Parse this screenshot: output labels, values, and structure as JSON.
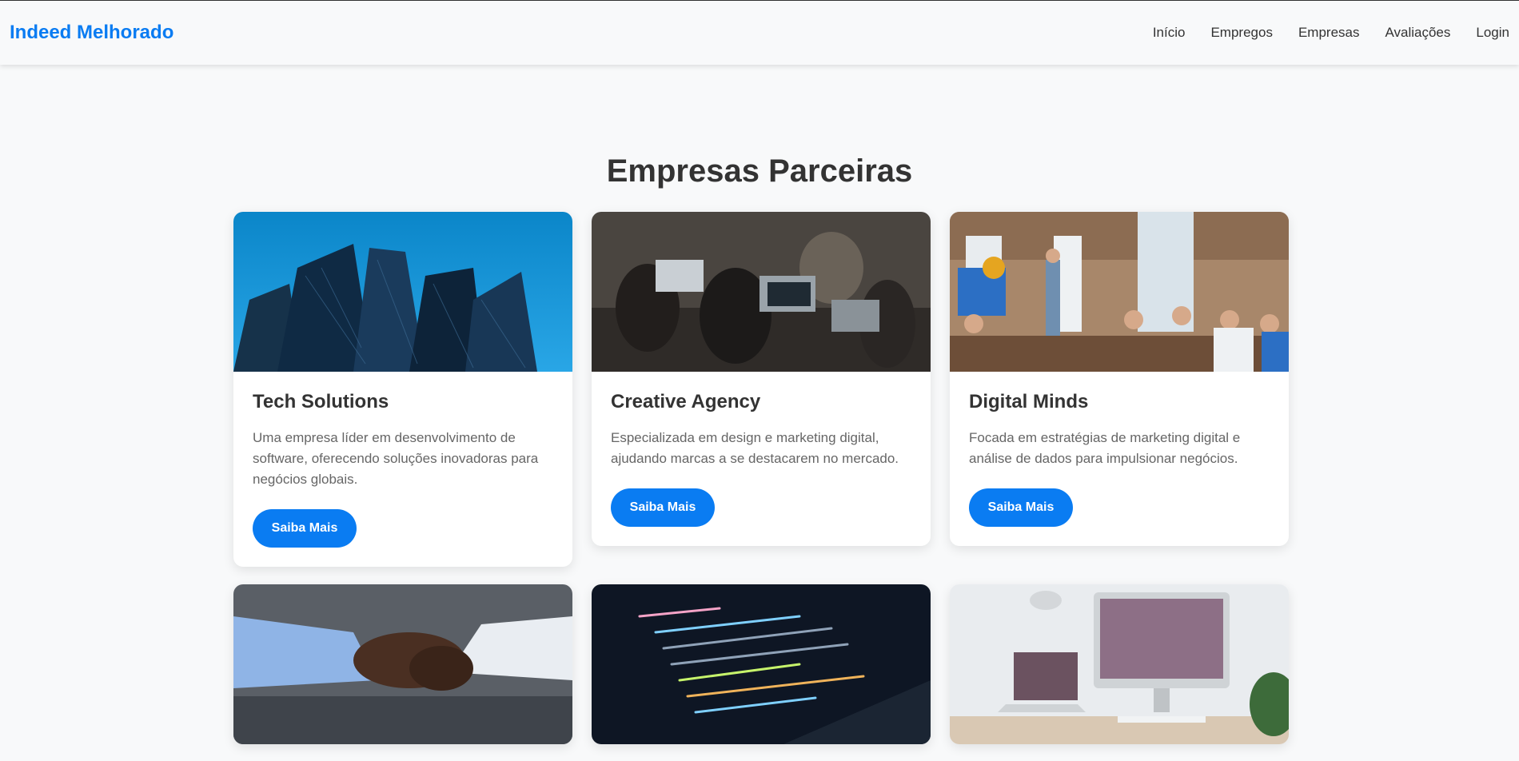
{
  "header": {
    "logo": "Indeed Melhorado",
    "nav": [
      "Início",
      "Empregos",
      "Empresas",
      "Avaliações",
      "Login"
    ]
  },
  "main": {
    "title": "Empresas Parceiras",
    "cards": [
      {
        "name": "Tech Solutions",
        "description": "Uma empresa líder em desenvolvimento de software, oferecendo soluções inovadoras para negócios globais.",
        "button": "Saiba Mais",
        "image": "office-building-photo"
      },
      {
        "name": "Creative Agency",
        "description": "Especializada em design e marketing digital, ajudando marcas a se destacarem no mercado.",
        "button": "Saiba Mais",
        "image": "team-laptops-photo"
      },
      {
        "name": "Digital Minds",
        "description": "Focada em estratégias de marketing digital e análise de dados para impulsionar negócios.",
        "button": "Saiba Mais",
        "image": "presentation-office-photo"
      },
      {
        "image": "handshake-photo"
      },
      {
        "image": "code-screen-photo"
      },
      {
        "image": "workspace-computer-photo"
      }
    ]
  },
  "colors": {
    "accent": "#0a7cf2",
    "background": "#f8f9fa",
    "text": "#333333"
  }
}
